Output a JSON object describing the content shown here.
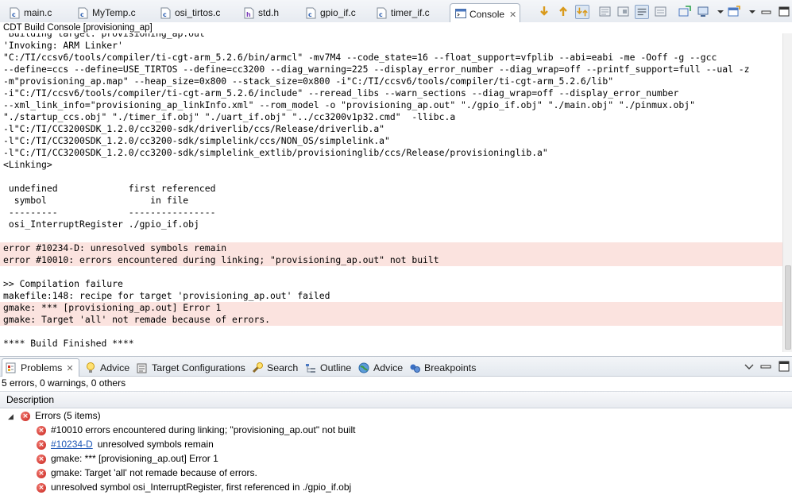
{
  "editor_tabs": [
    {
      "label": "main.c",
      "icon": "c-source-file-icon"
    },
    {
      "label": "MyTemp.c",
      "icon": "c-source-file-icon"
    },
    {
      "label": "osi_tirtos.c",
      "icon": "c-source-file-icon"
    },
    {
      "label": "std.h",
      "icon": "c-header-file-icon"
    },
    {
      "label": "gpio_if.c",
      "icon": "c-source-file-icon"
    },
    {
      "label": "timer_if.c",
      "icon": "c-source-file-icon"
    },
    {
      "label": "Console",
      "icon": "console-icon",
      "active": true
    }
  ],
  "console": {
    "title": "CDT Build Console [provisioning_ap]",
    "lines": [
      {
        "text": "'Building target: provisioning_ap.out'",
        "error": false
      },
      {
        "text": "'Invoking: ARM Linker'",
        "error": false
      },
      {
        "text": "\"C:/TI/ccsv6/tools/compiler/ti-cgt-arm_5.2.6/bin/armcl\" -mv7M4 --code_state=16 --float_support=vfplib --abi=eabi -me -Ooff -g --gcc",
        "error": false
      },
      {
        "text": "--define=ccs --define=USE_TIRTOS --define=cc3200 --diag_warning=225 --display_error_number --diag_wrap=off --printf_support=full --ual -z",
        "error": false
      },
      {
        "text": "-m\"provisioning_ap.map\" --heap_size=0x800 --stack_size=0x800 -i\"C:/TI/ccsv6/tools/compiler/ti-cgt-arm_5.2.6/lib\"",
        "error": false
      },
      {
        "text": "-i\"C:/TI/ccsv6/tools/compiler/ti-cgt-arm_5.2.6/include\" --reread_libs --warn_sections --diag_wrap=off --display_error_number",
        "error": false
      },
      {
        "text": "--xml_link_info=\"provisioning_ap_linkInfo.xml\" --rom_model -o \"provisioning_ap.out\" \"./gpio_if.obj\" \"./main.obj\" \"./pinmux.obj\"",
        "error": false
      },
      {
        "text": "\"./startup_ccs.obj\" \"./timer_if.obj\" \"./uart_if.obj\" \"../cc3200v1p32.cmd\"  -llibc.a",
        "error": false
      },
      {
        "text": "-l\"C:/TI/CC3200SDK_1.2.0/cc3200-sdk/driverlib/ccs/Release/driverlib.a\"",
        "error": false
      },
      {
        "text": "-l\"C:/TI/CC3200SDK_1.2.0/cc3200-sdk/simplelink/ccs/NON_OS/simplelink.a\"",
        "error": false
      },
      {
        "text": "-l\"C:/TI/CC3200SDK_1.2.0/cc3200-sdk/simplelink_extlib/provisioninglib/ccs/Release/provisioninglib.a\"",
        "error": false
      },
      {
        "text": "<Linking>",
        "error": false
      },
      {
        "text": "",
        "error": false
      },
      {
        "text": " undefined             first referenced",
        "error": false
      },
      {
        "text": "  symbol                   in file",
        "error": false
      },
      {
        "text": " ---------             ----------------",
        "error": false
      },
      {
        "text": " osi_InterruptRegister ./gpio_if.obj",
        "error": false
      },
      {
        "text": "",
        "error": false
      },
      {
        "text": "error #10234-D: unresolved symbols remain",
        "error": true
      },
      {
        "text": "error #10010: errors encountered during linking; \"provisioning_ap.out\" not built",
        "error": true
      },
      {
        "text": "",
        "error": false
      },
      {
        "text": ">> Compilation failure",
        "error": false
      },
      {
        "text": "makefile:148: recipe for target 'provisioning_ap.out' failed",
        "error": false
      },
      {
        "text": "gmake: *** [provisioning_ap.out] Error 1",
        "error": true
      },
      {
        "text": "gmake: Target 'all' not remade because of errors.",
        "error": true
      },
      {
        "text": "",
        "error": false
      },
      {
        "text": "**** Build Finished ****",
        "error": false
      }
    ]
  },
  "view_tabs": [
    {
      "label": "Problems",
      "icon": "problems-icon",
      "active": true
    },
    {
      "label": "Advice",
      "icon": "lightbulb-icon"
    },
    {
      "label": "Target Configurations",
      "icon": "target-config-icon"
    },
    {
      "label": "Search",
      "icon": "search-flashlight-icon"
    },
    {
      "label": "Outline",
      "icon": "outline-icon"
    },
    {
      "label": "Advice",
      "icon": "globe-icon"
    },
    {
      "label": "Breakpoints",
      "icon": "breakpoints-icon"
    }
  ],
  "problems": {
    "summary": "5 errors, 0 warnings, 0 others",
    "column_header": "Description",
    "group_label": "Errors (5 items)",
    "items": [
      {
        "link": "",
        "text": "#10010 errors encountered during linking; \"provisioning_ap.out\" not built"
      },
      {
        "link": "#10234-D",
        "text": "unresolved symbols remain"
      },
      {
        "link": "",
        "text": "gmake: *** [provisioning_ap.out] Error 1"
      },
      {
        "link": "",
        "text": "gmake: Target 'all' not remade because of errors."
      },
      {
        "link": "",
        "text": "unresolved symbol osi_InterruptRegister, first referenced in ./gpio_if.obj"
      }
    ]
  },
  "colors": {
    "error_highlight": "#fbe3df",
    "error_icon": "#d52b23",
    "link": "#1b55b5"
  }
}
